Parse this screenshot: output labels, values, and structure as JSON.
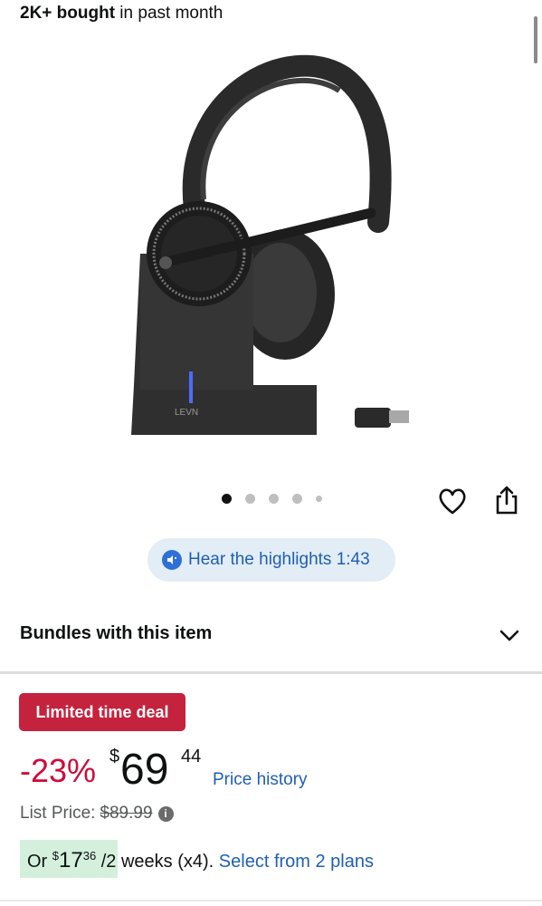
{
  "social_proof": {
    "count": "2K+ bought",
    "suffix": " in past month"
  },
  "product_image": {
    "alt": "LEVN headset with charging stand",
    "brand_text": "LEVN"
  },
  "carousel": {
    "count": 5,
    "active_index": 0
  },
  "icons": {
    "wishlist": "heart-icon",
    "share": "share-icon",
    "audio": "speaker-icon",
    "expand": "chevron-down-icon",
    "info": "info-icon"
  },
  "highlights": {
    "label": "Hear the highlights 1:43"
  },
  "bundles": {
    "title": "Bundles with this item"
  },
  "deal": {
    "badge": "Limited time deal"
  },
  "price": {
    "discount": "-23%",
    "currency": "$",
    "whole": "69",
    "fraction": "44",
    "history_link": "Price history"
  },
  "list_price": {
    "label": "List Price:",
    "value": "$89.99",
    "info": "i"
  },
  "installments": {
    "prefix": "Or ",
    "currency": "$",
    "whole": "17",
    "fraction": "36",
    "suffix": " /2 weeks (x4). ",
    "link": "Select from 2 plans"
  },
  "colors": {
    "accent_blue": "#1f5fb4",
    "deal_red": "#c4223d",
    "discount_red": "#cc0c39",
    "plan_green": "#d4f0dd"
  }
}
